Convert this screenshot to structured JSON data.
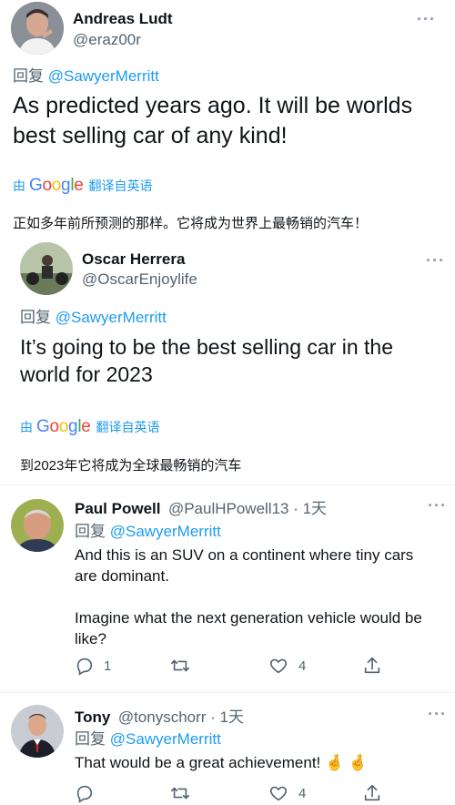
{
  "tweet1": {
    "name": "Andreas Ludt",
    "handle": "@eraz00r",
    "reply_prefix": "回复",
    "reply_to": "@SawyerMerritt",
    "text_line1": "As predicted years ago. It will be worlds",
    "text_line2": "best selling car of any kind!",
    "translate_by": "由",
    "translate_brand": "Google",
    "translate_action": "翻译自英语",
    "translation": "正如多年前所预测的那样。它将成为世界上最畅销的汽车！"
  },
  "quoted": {
    "name": "Oscar Herrera",
    "handle": "@OscarEnjoylife",
    "reply_prefix": "回复",
    "reply_to": "@SawyerMerritt",
    "text_line1": "It’s going to be the best selling car in the",
    "text_line2": "world for 2023",
    "translate_by": "由",
    "translate_brand": "Google",
    "translate_action": "翻译自英语",
    "translation": "到2023年它将成为全球最畅销的汽车"
  },
  "tweet2": {
    "name": "Paul Powell",
    "handle": "@PaulHPowell13 · 1天",
    "reply_prefix": "回复",
    "reply_to": "@SawyerMerritt",
    "text_line1": "And this is an SUV on a continent where tiny cars",
    "text_line2": "are dominant.",
    "text_line3": "Imagine what the next generation vehicle would be",
    "text_line4": "like?",
    "reply_count": "1",
    "like_count": "4"
  },
  "tweet3": {
    "name": "Tony",
    "handle": "@tonyschorr · 1天",
    "reply_prefix": "回复",
    "reply_to": "@SawyerMerritt",
    "text": "That would be a great achievement! ",
    "emoji": "🤞 🤞",
    "like_count": "4"
  },
  "icons": [
    "more-icon",
    "reply-icon",
    "retweet-icon",
    "like-icon",
    "share-icon"
  ],
  "colors": {
    "link": "#1d9bf0",
    "muted": "#536471",
    "divider": "#eff3f4"
  }
}
